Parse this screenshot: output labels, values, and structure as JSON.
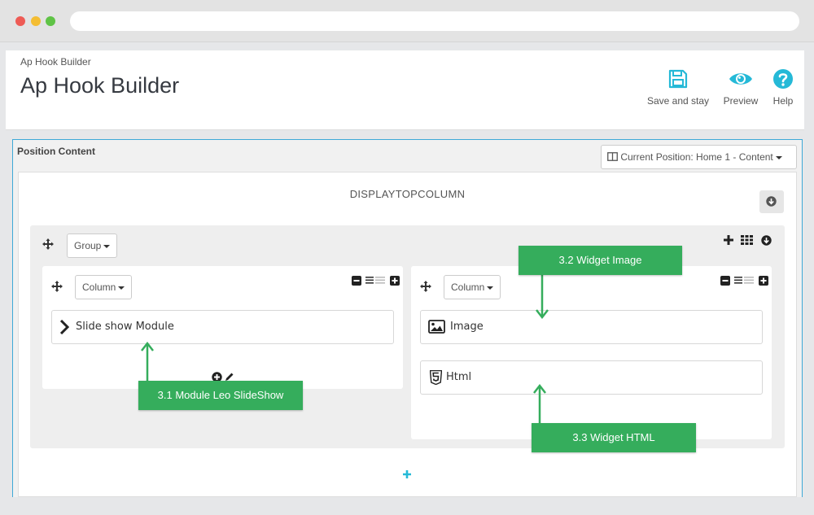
{
  "header": {
    "breadcrumb": "Ap Hook Builder",
    "title": "Ap Hook Builder",
    "toolbar": {
      "save_label": "Save and stay",
      "preview_label": "Preview",
      "help_label": "Help"
    }
  },
  "panel": {
    "title": "Position Content",
    "position_select": "Current Position: Home 1 - Content",
    "hook_name": "DISPLAYTOPCOLUMN",
    "group": {
      "dropdown_label": "Group",
      "columns": [
        {
          "dropdown_label": "Column",
          "widgets": [
            {
              "label": "Slide show Module",
              "icon": "chevron-right-icon"
            }
          ]
        },
        {
          "dropdown_label": "Column",
          "widgets": [
            {
              "label": "Image",
              "icon": "image-icon"
            },
            {
              "label": "Html",
              "icon": "html5-icon"
            }
          ]
        }
      ]
    }
  },
  "callouts": {
    "module_slideshow": "3.1 Module Leo SlideShow",
    "widget_image": "3.2 Widget Image",
    "widget_html": "3.3 Widget HTML"
  },
  "colors": {
    "accent_blue": "#3ea9d7",
    "callout_green": "#35ad5c",
    "icon_blue": "#25b9d7"
  }
}
